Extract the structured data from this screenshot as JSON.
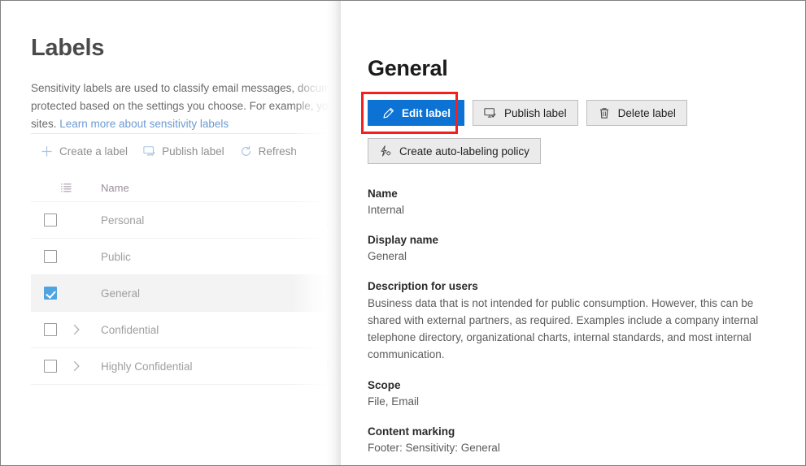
{
  "left": {
    "page_title": "Labels",
    "description_line1": "Sensitivity labels are used to classify email messages, docume",
    "description_line2": "protected based on the settings you choose. For example, you",
    "description_line3_prefix": "sites. ",
    "description_link": "Learn more about sensitivity labels",
    "commands": [
      {
        "label": "Create a label",
        "icon": "plus-icon"
      },
      {
        "label": "Publish label",
        "icon": "monitor-check-icon"
      },
      {
        "label": "Refresh",
        "icon": "refresh-icon"
      }
    ],
    "table": {
      "header_icon": "list-view-icon",
      "columns": [
        "Name"
      ],
      "rows": [
        {
          "name": "Personal",
          "checked": false,
          "expandable": false,
          "selected": false
        },
        {
          "name": "Public",
          "checked": false,
          "expandable": false,
          "selected": false
        },
        {
          "name": "General",
          "checked": true,
          "expandable": false,
          "selected": true
        },
        {
          "name": "Confidential",
          "checked": false,
          "expandable": true,
          "selected": false
        },
        {
          "name": "Highly Confidential",
          "checked": false,
          "expandable": true,
          "selected": false
        }
      ],
      "row_menu_icon": "more-vertical-icon",
      "expand_icon": "chevron-right-icon"
    }
  },
  "panel": {
    "title": "General",
    "buttons": [
      {
        "label": "Edit label",
        "icon": "pencil-icon",
        "primary": true,
        "highlighted": true
      },
      {
        "label": "Publish label",
        "icon": "monitor-check-icon",
        "primary": false,
        "highlighted": false
      },
      {
        "label": "Delete label",
        "icon": "trash-icon",
        "primary": false,
        "highlighted": false
      },
      {
        "label": "Create auto-labeling policy",
        "icon": "lightning-gear-icon",
        "primary": false,
        "highlighted": false
      }
    ],
    "fields": [
      {
        "label": "Name",
        "value": "Internal"
      },
      {
        "label": "Display name",
        "value": "General"
      },
      {
        "label": "Description for users",
        "value": "Business data that is not intended for public consumption. However, this can be shared with external partners, as required. Examples include a company internal telephone directory, organizational charts, internal standards, and most internal communication."
      },
      {
        "label": "Scope",
        "value": "File, Email"
      },
      {
        "label": "Content marking",
        "value": "Footer: Sensitivity: General"
      }
    ]
  },
  "colors": {
    "primary_button": "#0c72d4",
    "highlight_border": "#f41f1f",
    "checkbox_checked": "#50a5e0",
    "selected_row": "#f3f3f3",
    "link": "#6b9bd2",
    "window_border": "#808080"
  }
}
